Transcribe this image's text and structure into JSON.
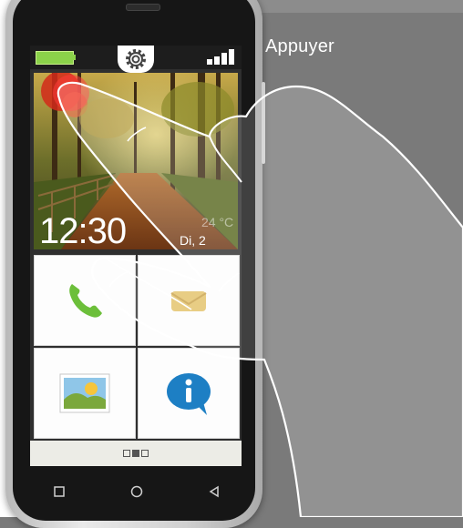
{
  "instruction": {
    "label": "Appuyer"
  },
  "status_bar": {
    "battery_icon": "battery-icon",
    "settings_icon": "gear-icon",
    "signal_icon": "signal-strength-icon"
  },
  "home_screen": {
    "time": "12:30",
    "date": "Di, 2",
    "temperature": "24 °C",
    "tiles": [
      {
        "icon": "phone-icon",
        "color": "#6cbf3a"
      },
      {
        "icon": "message-icon"
      },
      {
        "icon": "gallery-icon"
      },
      {
        "icon": "info-icon",
        "color": "#1d7fc4"
      }
    ],
    "page_indicator": {
      "pages": 3,
      "active": 2
    }
  },
  "navigation": {
    "recent_icon": "square-icon",
    "home_icon": "circle-icon",
    "back_icon": "back-triangle-icon"
  },
  "colors": {
    "background": "#7a7a7a",
    "battery": "#8bd24a",
    "phone_icon": "#6cbf3a",
    "info_icon": "#1d7fc4"
  }
}
